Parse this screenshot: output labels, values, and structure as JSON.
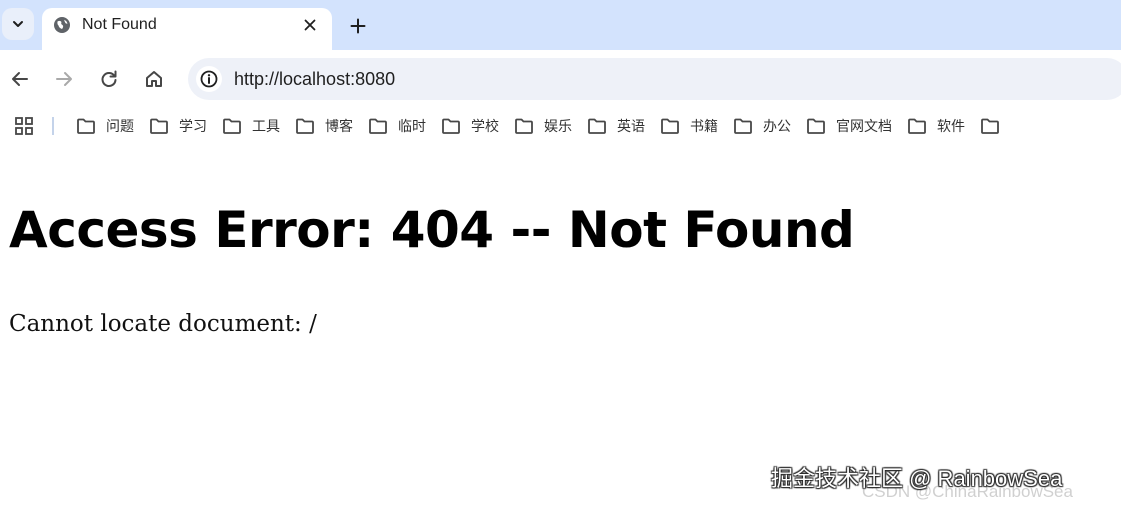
{
  "tab": {
    "title": "Not Found"
  },
  "omnibox": {
    "url": "http://localhost:8080"
  },
  "bookmarks": [
    {
      "label": "问题"
    },
    {
      "label": "学习"
    },
    {
      "label": "工具"
    },
    {
      "label": "博客"
    },
    {
      "label": "临时"
    },
    {
      "label": "学校"
    },
    {
      "label": "娱乐"
    },
    {
      "label": "英语"
    },
    {
      "label": "书籍"
    },
    {
      "label": "办公"
    },
    {
      "label": "官网文档"
    },
    {
      "label": "软件"
    },
    {
      "label": ""
    }
  ],
  "page": {
    "heading": "Access Error: 404 -- Not Found",
    "message": "Cannot locate document: /"
  },
  "watermark": {
    "main": "掘金技术社区 @ RainbowSea",
    "sub": "CSDN @ChinaRainbowSea"
  },
  "icons": {
    "tab_search": "chevron-down-icon",
    "favicon": "globe-icon",
    "close": "close-icon",
    "new_tab": "plus-icon",
    "back": "arrow-left-icon",
    "forward": "arrow-right-icon",
    "reload": "reload-icon",
    "home": "home-icon",
    "site_info": "info-icon",
    "apps": "apps-grid-icon",
    "folder": "folder-icon"
  },
  "colors": {
    "tabstrip": "#d3e3fd",
    "omnibox": "#eef1f8",
    "text": "#1f1f1f",
    "icon": "#474747",
    "forward_disabled": "#a9a9a9"
  }
}
